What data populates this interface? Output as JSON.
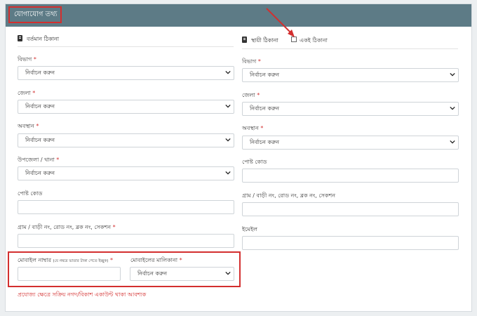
{
  "panel": {
    "title": "যোগাযোগ তথ্য"
  },
  "present": {
    "heading": "বর্তমান ঠিকানা",
    "division": {
      "label": "বিভাগ",
      "value": "নির্বাচন করুন"
    },
    "district": {
      "label": "জেলা",
      "value": "নির্বাচন করুন"
    },
    "area": {
      "label": "অবস্থান",
      "value": "নির্বাচন করুন"
    },
    "upazila": {
      "label": "উপজেলা / থানা",
      "value": "নির্বাচন করুন"
    },
    "postcode": {
      "label": "পোষ্ট কোড",
      "value": ""
    },
    "village": {
      "label": "গ্রাম / বাড়ী নং, রোড নং, ব্লক নং, সেকশন",
      "value": ""
    }
  },
  "permanent": {
    "heading": "স্থায়ী ঠিকানা",
    "same_address_label": "একই ঠিকানা",
    "same_address_checked": false,
    "division": {
      "label": "বিভাগ",
      "value": "নির্বাচন করুন"
    },
    "district": {
      "label": "জেলা",
      "value": "নির্বাচন করুন"
    },
    "area": {
      "label": "অবস্থান",
      "value": "নির্বাচন করুন"
    },
    "postcode": {
      "label": "পোষ্ট কোড",
      "value": ""
    },
    "village": {
      "label": "গ্রাম / বাড়ী নং, রোড নং, ব্লক নং, সেকশন",
      "value": ""
    },
    "email": {
      "label": "ইমেইল",
      "value": ""
    }
  },
  "mobile": {
    "label": "মোবাইল নাম্বার",
    "hint": "(যে নম্বরে ভাতার টাকা পেতে ইচ্ছুক)",
    "value": "",
    "owner_label": "মোবাইলের মালিকানা",
    "owner_value": "নির্বাচন করুন",
    "note": "প্রযোজ্য ক্ষেত্রে সক্রিয় নগদ/বিকাশ একাউন্ট থাকা আবশ্যক"
  },
  "required_mark": "*",
  "colors": {
    "header": "#5d7b86",
    "highlight": "#d32f2f"
  }
}
